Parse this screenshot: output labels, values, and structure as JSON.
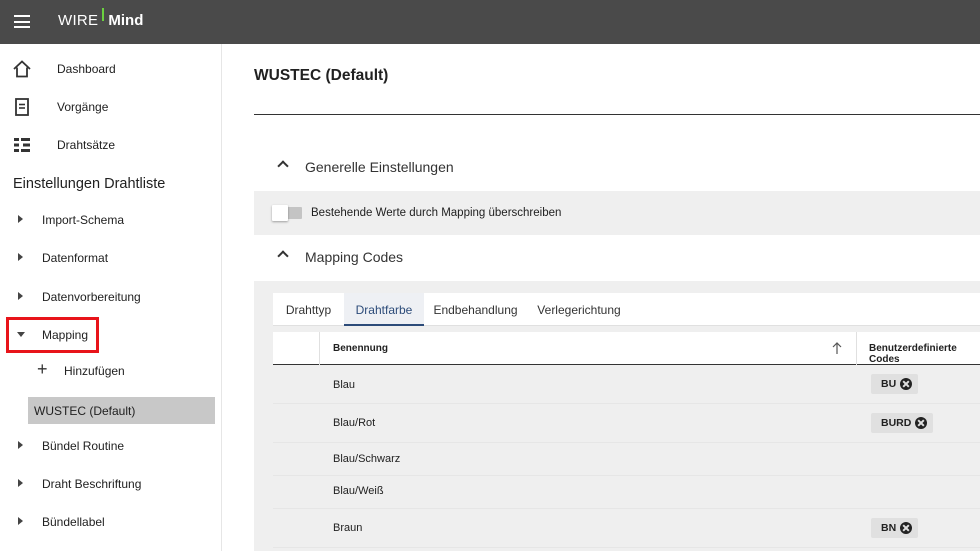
{
  "app": {
    "logo_wire": "WIRE",
    "logo_mind": "Mind",
    "accent_color": "#6bd13f"
  },
  "sidebar": {
    "nav": [
      {
        "label": "Dashboard",
        "icon": "home-icon"
      },
      {
        "label": "Vorgänge",
        "icon": "document-icon"
      },
      {
        "label": "Drahtsätze",
        "icon": "list-icon"
      }
    ],
    "section_title": "Einstellungen Drahtliste",
    "tree": [
      {
        "label": "Import-Schema",
        "expanded": false
      },
      {
        "label": "Datenformat",
        "expanded": false
      },
      {
        "label": "Datenvorbereitung",
        "expanded": false
      },
      {
        "label": "Mapping",
        "expanded": true
      },
      {
        "label": "Bündel Routine",
        "expanded": false
      },
      {
        "label": "Draht Beschriftung",
        "expanded": false
      },
      {
        "label": "Bündellabel",
        "expanded": false
      }
    ],
    "mapping_children": {
      "add_label": "Hinzufügen",
      "selected_label": "WUSTEC (Default)"
    },
    "highlight_color": "#e8141a"
  },
  "main": {
    "title": "WUSTEC (Default)",
    "general_panel": {
      "title": "Generelle Einstellungen",
      "toggle_label": "Bestehende Werte durch Mapping überschreiben",
      "toggle_on": false
    },
    "mapping_panel": {
      "title": "Mapping Codes",
      "tabs": [
        {
          "label": "Drahttyp",
          "active": false
        },
        {
          "label": "Drahtfarbe",
          "active": true
        },
        {
          "label": "Endbehandlung",
          "active": false
        },
        {
          "label": "Verlegerichtung",
          "active": false
        }
      ],
      "table": {
        "columns": [
          "Benennung",
          "Benutzerdefinierte Codes"
        ],
        "sort": "ascending",
        "rows": [
          {
            "name": "Blau",
            "codes": [
              "BU"
            ]
          },
          {
            "name": "Blau/Rot",
            "codes": [
              "BURD"
            ]
          },
          {
            "name": "Blau/Schwarz",
            "codes": []
          },
          {
            "name": "Blau/Weiß",
            "codes": []
          },
          {
            "name": "Braun",
            "codes": [
              "BN"
            ]
          }
        ]
      }
    }
  }
}
